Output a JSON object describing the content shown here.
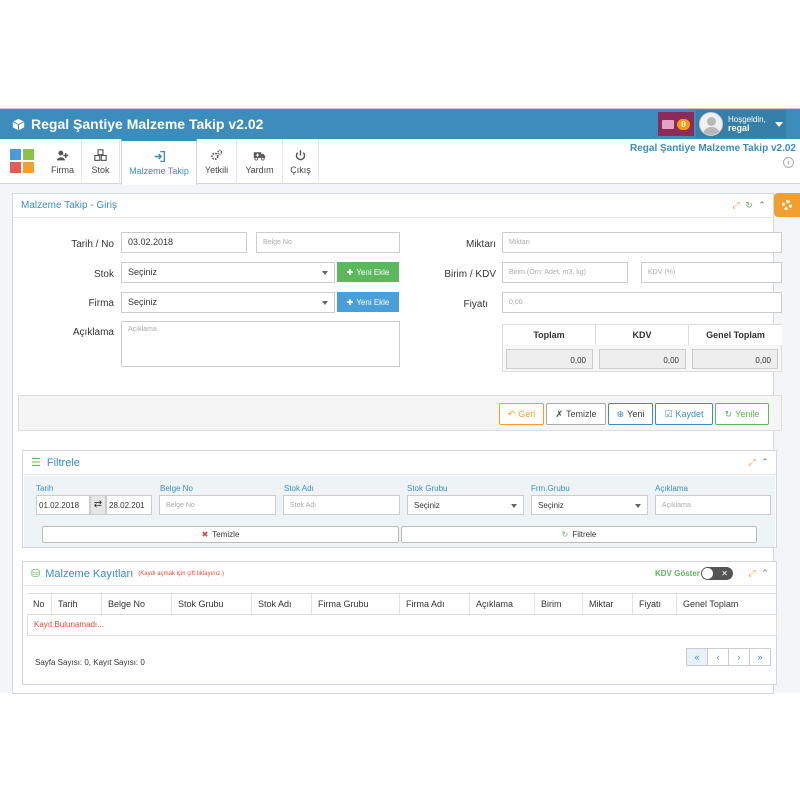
{
  "header": {
    "title": "Regal Şantiye Malzeme Takip v2.02",
    "notification_count": "0",
    "greeting": "Hoşgeldin,",
    "username": "regal"
  },
  "nav": {
    "items": [
      {
        "label": "Firma"
      },
      {
        "label": "Stok"
      },
      {
        "label": "Malzeme Takip"
      },
      {
        "label": "Yetkili"
      },
      {
        "label": "Yardım"
      },
      {
        "label": "Çıkış"
      }
    ]
  },
  "toolbar": {
    "app_title": "Regal Şantiye Malzeme Takip v2.02"
  },
  "entry": {
    "title": "Malzeme Takip - Giriş",
    "date_label": "Tarih / No",
    "date_value": "03.02.2018",
    "doc_no_placeholder": "Belge No",
    "stock_label": "Stok",
    "stock_value": "Seçiniz",
    "add_new": "Yeni Ekle",
    "firm_label": "Firma",
    "firm_value": "Seçiniz",
    "desc_label": "Açıklama",
    "desc_placeholder": "Açıklama",
    "qty_label": "Miktarı",
    "qty_placeholder": "Miktarı",
    "unit_label": "Birim / KDV",
    "unit_placeholder": "Birim (Örn: Adet, m3, kg)",
    "kdv_placeholder": "KDV (%)",
    "price_label": "Fiyatı",
    "price_placeholder": "0,00",
    "totals_headers": [
      "Toplam",
      "KDV",
      "Genel Toplam"
    ],
    "totals_values": [
      "0,00",
      "0,00",
      "0,00"
    ]
  },
  "actions": {
    "back": "Geri",
    "clear": "Temizle",
    "new": "Yeni",
    "save": "Kaydet",
    "refresh": "Yenile"
  },
  "filter": {
    "title": "Filtrele",
    "labels": {
      "date": "Tarih",
      "doc": "Belge No",
      "stock": "Stok Adı",
      "group": "Stok Grubu",
      "firm_group": "Frm.Grubu",
      "desc": "Açıklama"
    },
    "date_from": "01.02.2018",
    "date_to": "28.02.201",
    "doc_placeholder": "Belge No",
    "stock_placeholder": "Stok Adı",
    "group_value": "Seçiniz",
    "firm_group_value": "Seçiniz",
    "desc_placeholder": "Açıklama",
    "clear_button": "Temizle",
    "filter_button": "Filtrele"
  },
  "records": {
    "title": "Malzeme Kayıtları",
    "hint": "(Kaydı açmak için çift tıklayınız.)",
    "kdv_toggle": "KDV Göster",
    "columns": [
      "No",
      "Tarih",
      "Belge No",
      "Stok Grubu",
      "Stok Adı",
      "Firma Grubu",
      "Firma Adı",
      "Açıklama",
      "Birim",
      "Miktar",
      "Fiyatı",
      "Genel Toplam"
    ],
    "empty_text": "Kayıt Bulunamadı...",
    "summary": "Sayfa Sayısı: 0, Kayıt Sayısı: 0",
    "pager": [
      "«",
      "‹",
      "›",
      "»"
    ]
  },
  "colors": {
    "primary": "#3c8dbc",
    "success": "#5cb85c",
    "warning": "#f0a030",
    "danger": "#dd4b39"
  }
}
